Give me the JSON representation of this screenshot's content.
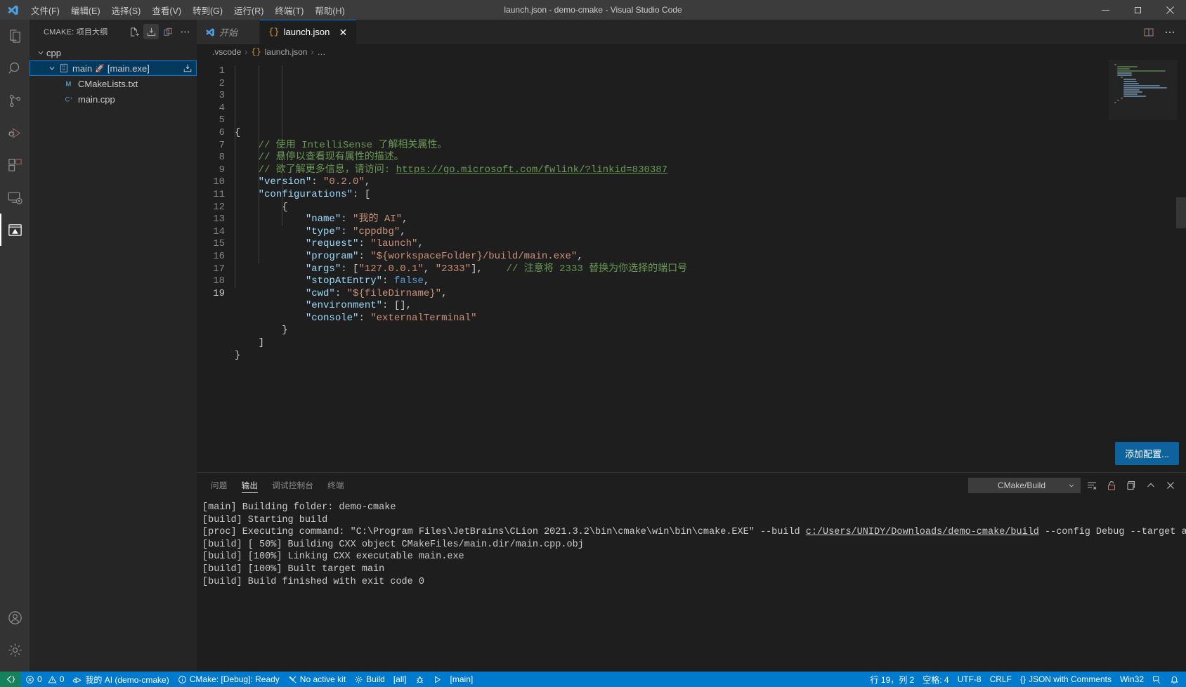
{
  "window": {
    "title": "launch.json - demo-cmake - Visual Studio Code",
    "minimize": "−",
    "maximize": "❐",
    "close": "✕"
  },
  "menubar": {
    "items": [
      {
        "label": "文件(F)",
        "name": "menu-file"
      },
      {
        "label": "编辑(E)",
        "name": "menu-edit"
      },
      {
        "label": "选择(S)",
        "name": "menu-selection"
      },
      {
        "label": "查看(V)",
        "name": "menu-view"
      },
      {
        "label": "转到(G)",
        "name": "menu-goto"
      },
      {
        "label": "运行(R)",
        "name": "menu-run"
      },
      {
        "label": "终端(T)",
        "name": "menu-terminal"
      },
      {
        "label": "帮助(H)",
        "name": "menu-help"
      }
    ]
  },
  "activitybar": {
    "items": [
      {
        "icon": "explorer-icon",
        "active": false
      },
      {
        "icon": "search-icon",
        "active": false
      },
      {
        "icon": "source-control-icon",
        "active": false
      },
      {
        "icon": "run-and-debug-icon",
        "active": false
      },
      {
        "icon": "extensions-icon",
        "active": false
      },
      {
        "icon": "remote-explorer-icon",
        "active": false
      },
      {
        "icon": "cmake-icon",
        "active": true
      }
    ],
    "bottom": [
      {
        "icon": "account-icon"
      },
      {
        "icon": "gear-icon"
      }
    ]
  },
  "sidebar": {
    "title": "CMAKE: 项目大纲",
    "actions": [
      {
        "icon": "configure-all-projects-icon",
        "pressed": false
      },
      {
        "icon": "build-all-projects-icon",
        "pressed": true
      },
      {
        "icon": "clean-rebuild-icon",
        "pressed": false
      },
      {
        "icon": "more-actions-icon",
        "pressed": false
      }
    ],
    "tree": [
      {
        "label": "cpp",
        "indent": 1,
        "expanded": true,
        "icon": "none",
        "selected": false
      },
      {
        "label": "main",
        "suffix": "[main.exe]",
        "indent": 2,
        "expanded": true,
        "icon": "binary-icon",
        "badge": "🚀",
        "selected": true,
        "action_icon": "build-target-icon"
      },
      {
        "label": "CMakeLists.txt",
        "indent": 3,
        "expanded": null,
        "icon": "cmake-file-icon",
        "selected": false
      },
      {
        "label": "main.cpp",
        "indent": 3,
        "expanded": null,
        "icon": "cpp-file-icon",
        "selected": false
      }
    ]
  },
  "tabs": {
    "items": [
      {
        "label": "开始",
        "icon": "vscode-icon",
        "active": false,
        "italic": true,
        "closable": false
      },
      {
        "label": "launch.json",
        "icon": "json-icon",
        "active": true,
        "italic": false,
        "closable": true,
        "close": "✕"
      }
    ],
    "actions": [
      {
        "icon": "split-editor-icon"
      },
      {
        "icon": "more-actions-icon"
      }
    ]
  },
  "breadcrumb": {
    "items": [
      ".vscode",
      "launch.json",
      "…"
    ],
    "separator": "›",
    "json_glyph": "{}"
  },
  "editor": {
    "language": "JSON with Comments",
    "lines": [
      {
        "n": 1,
        "tokens": [
          {
            "t": "punct",
            "v": "{"
          }
        ]
      },
      {
        "n": 2,
        "tokens": [
          {
            "t": "cmt",
            "v": "    // 使用 IntelliSense 了解相关属性。"
          }
        ]
      },
      {
        "n": 3,
        "tokens": [
          {
            "t": "cmt",
            "v": "    // 悬停以查看现有属性的描述。"
          }
        ]
      },
      {
        "n": 4,
        "tokens": [
          {
            "t": "cmt",
            "v": "    // 欲了解更多信息，请访问: "
          },
          {
            "t": "link",
            "v": "https://go.microsoft.com/fwlink/?linkid=830387"
          }
        ]
      },
      {
        "n": 5,
        "tokens": [
          {
            "t": "key",
            "v": "    \"version\""
          },
          {
            "t": "punct",
            "v": ": "
          },
          {
            "t": "str",
            "v": "\"0.2.0\""
          },
          {
            "t": "punct",
            "v": ","
          }
        ]
      },
      {
        "n": 6,
        "tokens": [
          {
            "t": "key",
            "v": "    \"configurations\""
          },
          {
            "t": "punct",
            "v": ": ["
          }
        ]
      },
      {
        "n": 7,
        "tokens": [
          {
            "t": "punct",
            "v": "        {"
          }
        ]
      },
      {
        "n": 8,
        "tokens": [
          {
            "t": "key",
            "v": "            \"name\""
          },
          {
            "t": "punct",
            "v": ": "
          },
          {
            "t": "str",
            "v": "\"我的 AI\""
          },
          {
            "t": "punct",
            "v": ","
          }
        ]
      },
      {
        "n": 9,
        "tokens": [
          {
            "t": "key",
            "v": "            \"type\""
          },
          {
            "t": "punct",
            "v": ": "
          },
          {
            "t": "str",
            "v": "\"cppdbg\""
          },
          {
            "t": "punct",
            "v": ","
          }
        ]
      },
      {
        "n": 10,
        "tokens": [
          {
            "t": "key",
            "v": "            \"request\""
          },
          {
            "t": "punct",
            "v": ": "
          },
          {
            "t": "str",
            "v": "\"launch\""
          },
          {
            "t": "punct",
            "v": ","
          }
        ]
      },
      {
        "n": 11,
        "tokens": [
          {
            "t": "key",
            "v": "            \"program\""
          },
          {
            "t": "punct",
            "v": ": "
          },
          {
            "t": "str",
            "v": "\"${workspaceFolder}/build/main.exe\""
          },
          {
            "t": "punct",
            "v": ","
          }
        ]
      },
      {
        "n": 12,
        "tokens": [
          {
            "t": "key",
            "v": "            \"args\""
          },
          {
            "t": "punct",
            "v": ": ["
          },
          {
            "t": "str",
            "v": "\"127.0.0.1\""
          },
          {
            "t": "punct",
            "v": ", "
          },
          {
            "t": "str",
            "v": "\"2333\""
          },
          {
            "t": "punct",
            "v": "],    "
          },
          {
            "t": "cmt",
            "v": "// 注意将 2333 替换为你选择的端口号"
          }
        ]
      },
      {
        "n": 13,
        "tokens": [
          {
            "t": "key",
            "v": "            \"stopAtEntry\""
          },
          {
            "t": "punct",
            "v": ": "
          },
          {
            "t": "bool",
            "v": "false"
          },
          {
            "t": "punct",
            "v": ","
          }
        ]
      },
      {
        "n": 14,
        "tokens": [
          {
            "t": "key",
            "v": "            \"cwd\""
          },
          {
            "t": "punct",
            "v": ": "
          },
          {
            "t": "str",
            "v": "\"${fileDirname}\""
          },
          {
            "t": "punct",
            "v": ","
          }
        ]
      },
      {
        "n": 15,
        "tokens": [
          {
            "t": "key",
            "v": "            \"environment\""
          },
          {
            "t": "punct",
            "v": ": []"
          },
          {
            "t": "punct",
            "v": ","
          }
        ]
      },
      {
        "n": 16,
        "tokens": [
          {
            "t": "key",
            "v": "            \"console\""
          },
          {
            "t": "punct",
            "v": ": "
          },
          {
            "t": "str",
            "v": "\"externalTerminal\""
          }
        ]
      },
      {
        "n": 17,
        "tokens": [
          {
            "t": "punct",
            "v": "        }"
          }
        ]
      },
      {
        "n": 18,
        "tokens": [
          {
            "t": "punct",
            "v": "    ]"
          }
        ]
      },
      {
        "n": 19,
        "tokens": [
          {
            "t": "punct",
            "v": "}"
          }
        ]
      }
    ],
    "add_config_button": "添加配置..."
  },
  "panel": {
    "tabs": [
      {
        "label": "问题",
        "active": false
      },
      {
        "label": "输出",
        "active": true
      },
      {
        "label": "调试控制台",
        "active": false
      },
      {
        "label": "终端",
        "active": false
      }
    ],
    "channel": "CMake/Build",
    "tools": [
      {
        "icon": "clear-output-icon"
      },
      {
        "icon": "unlock-icon"
      },
      {
        "icon": "open-in-new-window-icon"
      },
      {
        "icon": "chevron-up-icon"
      },
      {
        "icon": "close-icon"
      }
    ],
    "output": [
      {
        "segments": [
          {
            "t": "text",
            "v": "[main] Building folder: demo-cmake"
          }
        ]
      },
      {
        "segments": [
          {
            "t": "text",
            "v": "[build] Starting build"
          }
        ]
      },
      {
        "segments": [
          {
            "t": "text",
            "v": "[proc] Executing command: \"C:\\Program Files\\JetBrains\\CLion 2021.3.2\\bin\\cmake\\win\\bin\\cmake.EXE\" --build "
          },
          {
            "t": "link",
            "v": "c:/Users/UNIDY/Downloads/demo-cmake/build"
          },
          {
            "t": "text",
            "v": " --config Debug --target all --"
          }
        ]
      },
      {
        "segments": [
          {
            "t": "text",
            "v": "[build] [ 50%] Building CXX object CMakeFiles/main.dir/main.cpp.obj"
          }
        ]
      },
      {
        "segments": [
          {
            "t": "text",
            "v": "[build] [100%] Linking CXX executable main.exe"
          }
        ]
      },
      {
        "segments": [
          {
            "t": "text",
            "v": "[build] [100%] Built target main"
          }
        ]
      },
      {
        "segments": [
          {
            "t": "text",
            "v": "[build] Build finished with exit code 0"
          }
        ]
      }
    ]
  },
  "statusbar": {
    "remote_icon": "remote-window-icon",
    "left": [
      {
        "icon": "error-icon",
        "label": "0",
        "second_icon": "warning-icon",
        "second_label": "0",
        "name": "problems-status"
      },
      {
        "icon": "debug-config-icon",
        "label": "我的 AI (demo-cmake)",
        "name": "debug-config-status"
      },
      {
        "icon": "info-icon",
        "label": "CMake: [Debug]: Ready",
        "name": "cmake-status"
      },
      {
        "icon": "tools-icon",
        "label": "No active kit",
        "name": "kit-status"
      },
      {
        "icon": "gear-small-icon",
        "label": "Build",
        "name": "build-status"
      },
      {
        "icon": "none",
        "label": "[all]",
        "name": "build-target-status"
      },
      {
        "icon": "bug-icon",
        "label": "",
        "name": "debug-status"
      },
      {
        "icon": "play-icon",
        "label": "",
        "name": "launch-status"
      },
      {
        "icon": "none",
        "label": "[main]",
        "name": "launch-target-status"
      }
    ],
    "right": [
      {
        "label": "行 19，列 2",
        "name": "cursor-position-status"
      },
      {
        "label": "空格: 4",
        "name": "indentation-status"
      },
      {
        "label": "UTF-8",
        "name": "encoding-status"
      },
      {
        "label": "CRLF",
        "name": "eol-status"
      },
      {
        "label": "JSON with Comments",
        "icon": "json-icon",
        "name": "language-mode-status"
      },
      {
        "label": "Win32",
        "name": "platform-status"
      },
      {
        "label": "",
        "icon": "feedback-icon",
        "name": "feedback-status"
      },
      {
        "label": "",
        "icon": "bell-icon",
        "name": "notifications-status"
      }
    ]
  },
  "colors": {
    "accent": "#007acc",
    "titlebar": "#3c3c3c",
    "activitybar": "#333333",
    "sidebar": "#252526",
    "editor": "#1e1e1e",
    "selection": "#04395e",
    "button": "#0e639c",
    "remote": "#16825d"
  }
}
